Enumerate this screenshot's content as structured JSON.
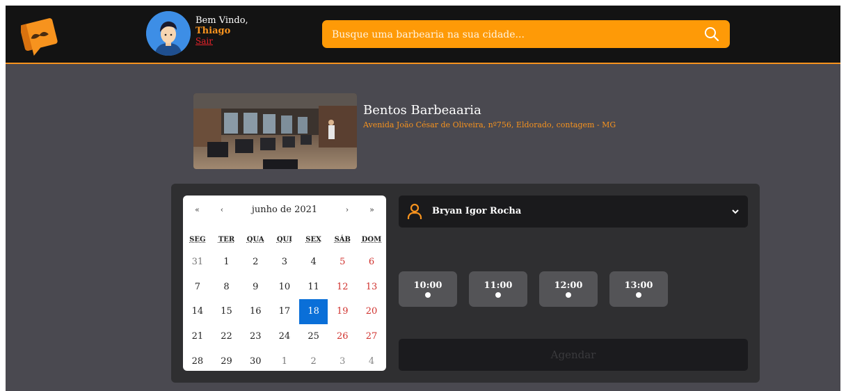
{
  "header": {
    "welcome": "Bem Vindo,",
    "username": "Thiago",
    "logout": "Sair",
    "search_placeholder": "Busque uma barbearia na sua cidade..."
  },
  "shop": {
    "name": "Bentos Barbeaaria",
    "address": "Avenida João César de Oliveira, nº756, Eldorado, contagem - MG"
  },
  "calendar": {
    "nav_first": "«",
    "nav_prev": "‹",
    "month": "junho de 2021",
    "nav_next": "›",
    "nav_last": "»",
    "weekdays": [
      "SEG",
      "TER",
      "QUA",
      "QUI",
      "SEX",
      "SÁB",
      "DOM"
    ],
    "days": [
      [
        "31",
        "1",
        "2",
        "3",
        "4",
        "5",
        "6"
      ],
      [
        "7",
        "8",
        "9",
        "10",
        "11",
        "12",
        "13"
      ],
      [
        "14",
        "15",
        "16",
        "17",
        "18",
        "19",
        "20"
      ],
      [
        "21",
        "22",
        "23",
        "24",
        "25",
        "26",
        "27"
      ],
      [
        "28",
        "29",
        "30",
        "1",
        "2",
        "3",
        "4"
      ]
    ],
    "selected_day": "18"
  },
  "booking": {
    "barber": "Bryan Igor Rocha",
    "slots": [
      "10:00",
      "11:00",
      "12:00",
      "13:00"
    ],
    "submit": "Agendar"
  },
  "colors": {
    "accent": "#f7931e",
    "search_bg": "#fe9a07",
    "selected_day": "#0a6fd8",
    "weekend": "#d0312d"
  }
}
